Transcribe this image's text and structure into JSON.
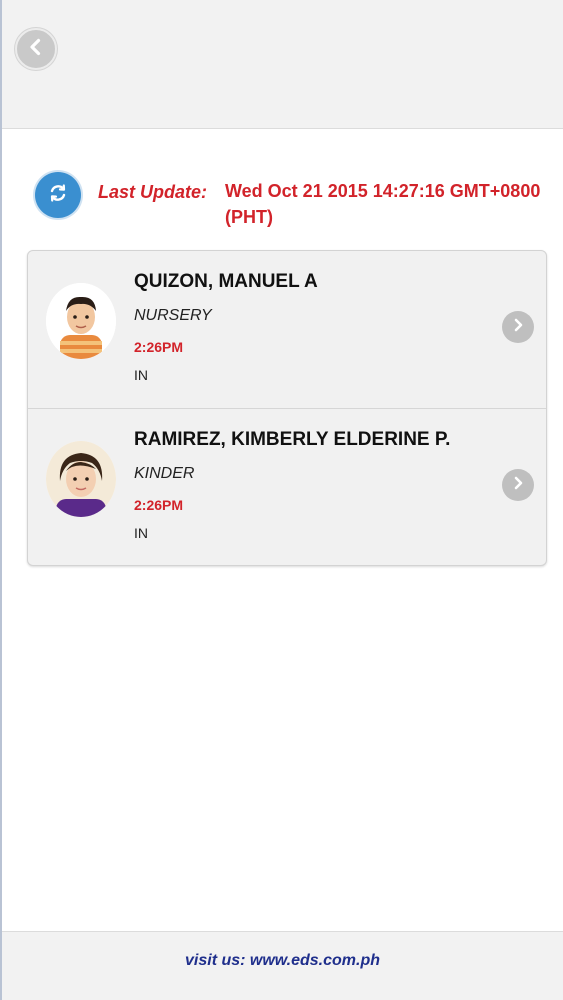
{
  "header": {
    "back_icon": "chevron-left-icon"
  },
  "update": {
    "label": "Last Update:",
    "value": "Wed Oct 21 2015 14:27:16 GMT+0800 (PHT)",
    "refresh_icon": "refresh-icon"
  },
  "students": [
    {
      "name": "QUIZON, MANUEL A",
      "grade": "NURSERY",
      "time": "2:26PM",
      "status": "IN"
    },
    {
      "name": "RAMIREZ, KIMBERLY ELDERINE P.",
      "grade": "KINDER",
      "time": "2:26PM",
      "status": "IN"
    }
  ],
  "footer": {
    "link": "visit us: www.eds.com.ph"
  },
  "colors": {
    "accent_red": "#d2232a",
    "refresh_blue": "#3a8fd0",
    "footer_link": "#1f2f8c"
  }
}
